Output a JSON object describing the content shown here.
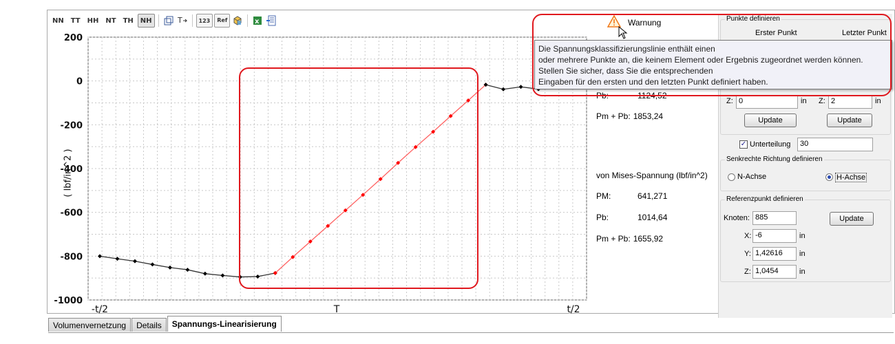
{
  "toolbar": {
    "buttons": [
      "NN",
      "TT",
      "HH",
      "NT",
      "TH",
      "NH"
    ],
    "active": "NH",
    "btn_123": "123",
    "btn_ref": "Ref"
  },
  "chart_data": {
    "type": "line",
    "ylabel": "( lbf/in^2 )",
    "ylim": [
      -1000,
      200
    ],
    "yticks": [
      "200",
      "0",
      "-200",
      "-400",
      "-600",
      "-800",
      "-1000"
    ],
    "xticks": [
      "-t/2",
      "T",
      "t/2"
    ],
    "grid": true,
    "series": [
      {
        "color": "#000000",
        "points": [
          [
            0,
            -800
          ],
          [
            1,
            -812
          ],
          [
            2,
            -823
          ],
          [
            3,
            -838
          ],
          [
            4,
            -852
          ],
          [
            5,
            -862
          ],
          [
            6,
            -880
          ],
          [
            7,
            -888
          ],
          [
            8,
            -895
          ],
          [
            9,
            -893
          ],
          [
            10,
            -877
          ]
        ]
      },
      {
        "color": "#ff0000",
        "points": [
          [
            10,
            -877
          ],
          [
            11,
            -804
          ],
          [
            12,
            -733
          ],
          [
            13,
            -662
          ],
          [
            14,
            -591
          ],
          [
            15,
            -520
          ],
          [
            16,
            -448
          ],
          [
            17,
            -374
          ],
          [
            18,
            -302
          ],
          [
            19,
            -232
          ],
          [
            20,
            -160
          ],
          [
            21,
            -89
          ],
          [
            22,
            -17
          ]
        ]
      },
      {
        "color": "#000000",
        "points": [
          [
            22,
            -17
          ],
          [
            23,
            -38
          ],
          [
            24,
            -27
          ],
          [
            25,
            -37
          ],
          [
            26,
            -27
          ],
          [
            27,
            -12
          ]
        ]
      }
    ]
  },
  "results": {
    "pb_label": "Pb:",
    "pb_value": "1124,52",
    "pmpb_label": "Pm + Pb:",
    "pmpb_value": "1853,24",
    "mises_title": "von Mises-Spannung (lbf/in^2)",
    "pm2_label": "PM:",
    "pm2_value": "641,271",
    "pb2_label": "Pb:",
    "pb2_value": "1014,64",
    "pmpb2_label": "Pm + Pb:",
    "pmpb2_value": "1655,92"
  },
  "warning": {
    "title": "Warnung",
    "text": [
      "Die Spannungsklassifizierungslinie enthält einen",
      "oder mehrere Punkte an, die keinem Element oder Ergebnis zugeordnet werden können.",
      "Stellen Sie sicher, dass Sie die entsprechenden",
      "Eingaben für den ersten und den letzten Punkt definiert haben."
    ]
  },
  "panel": {
    "punkte_title": "Punkte definieren",
    "erster": "Erster Punkt",
    "letzter": "Letzter Punkt",
    "z_label": "Z:",
    "z1": "0",
    "z2": "2",
    "unit_in": "in",
    "update": "Update",
    "unterteilung_label": "Unterteilung",
    "unterteilung_value": "30",
    "richtung_title": "Senkrechte Richtung definieren",
    "n_achse": "N-Achse",
    "h_achse": "H-Achse",
    "referenz_title": "Referenzpunkt definieren",
    "knoten_label": "Knoten:",
    "knoten_value": "885",
    "x_label": "X:",
    "x_value": "-6",
    "y_label": "Y:",
    "y_value": "1,42616",
    "z3_label": "Z:",
    "z3_value": "1,0454"
  },
  "tabs": [
    "Volumenvernetzung",
    "Details",
    "Spannungs-Linearisierung"
  ]
}
